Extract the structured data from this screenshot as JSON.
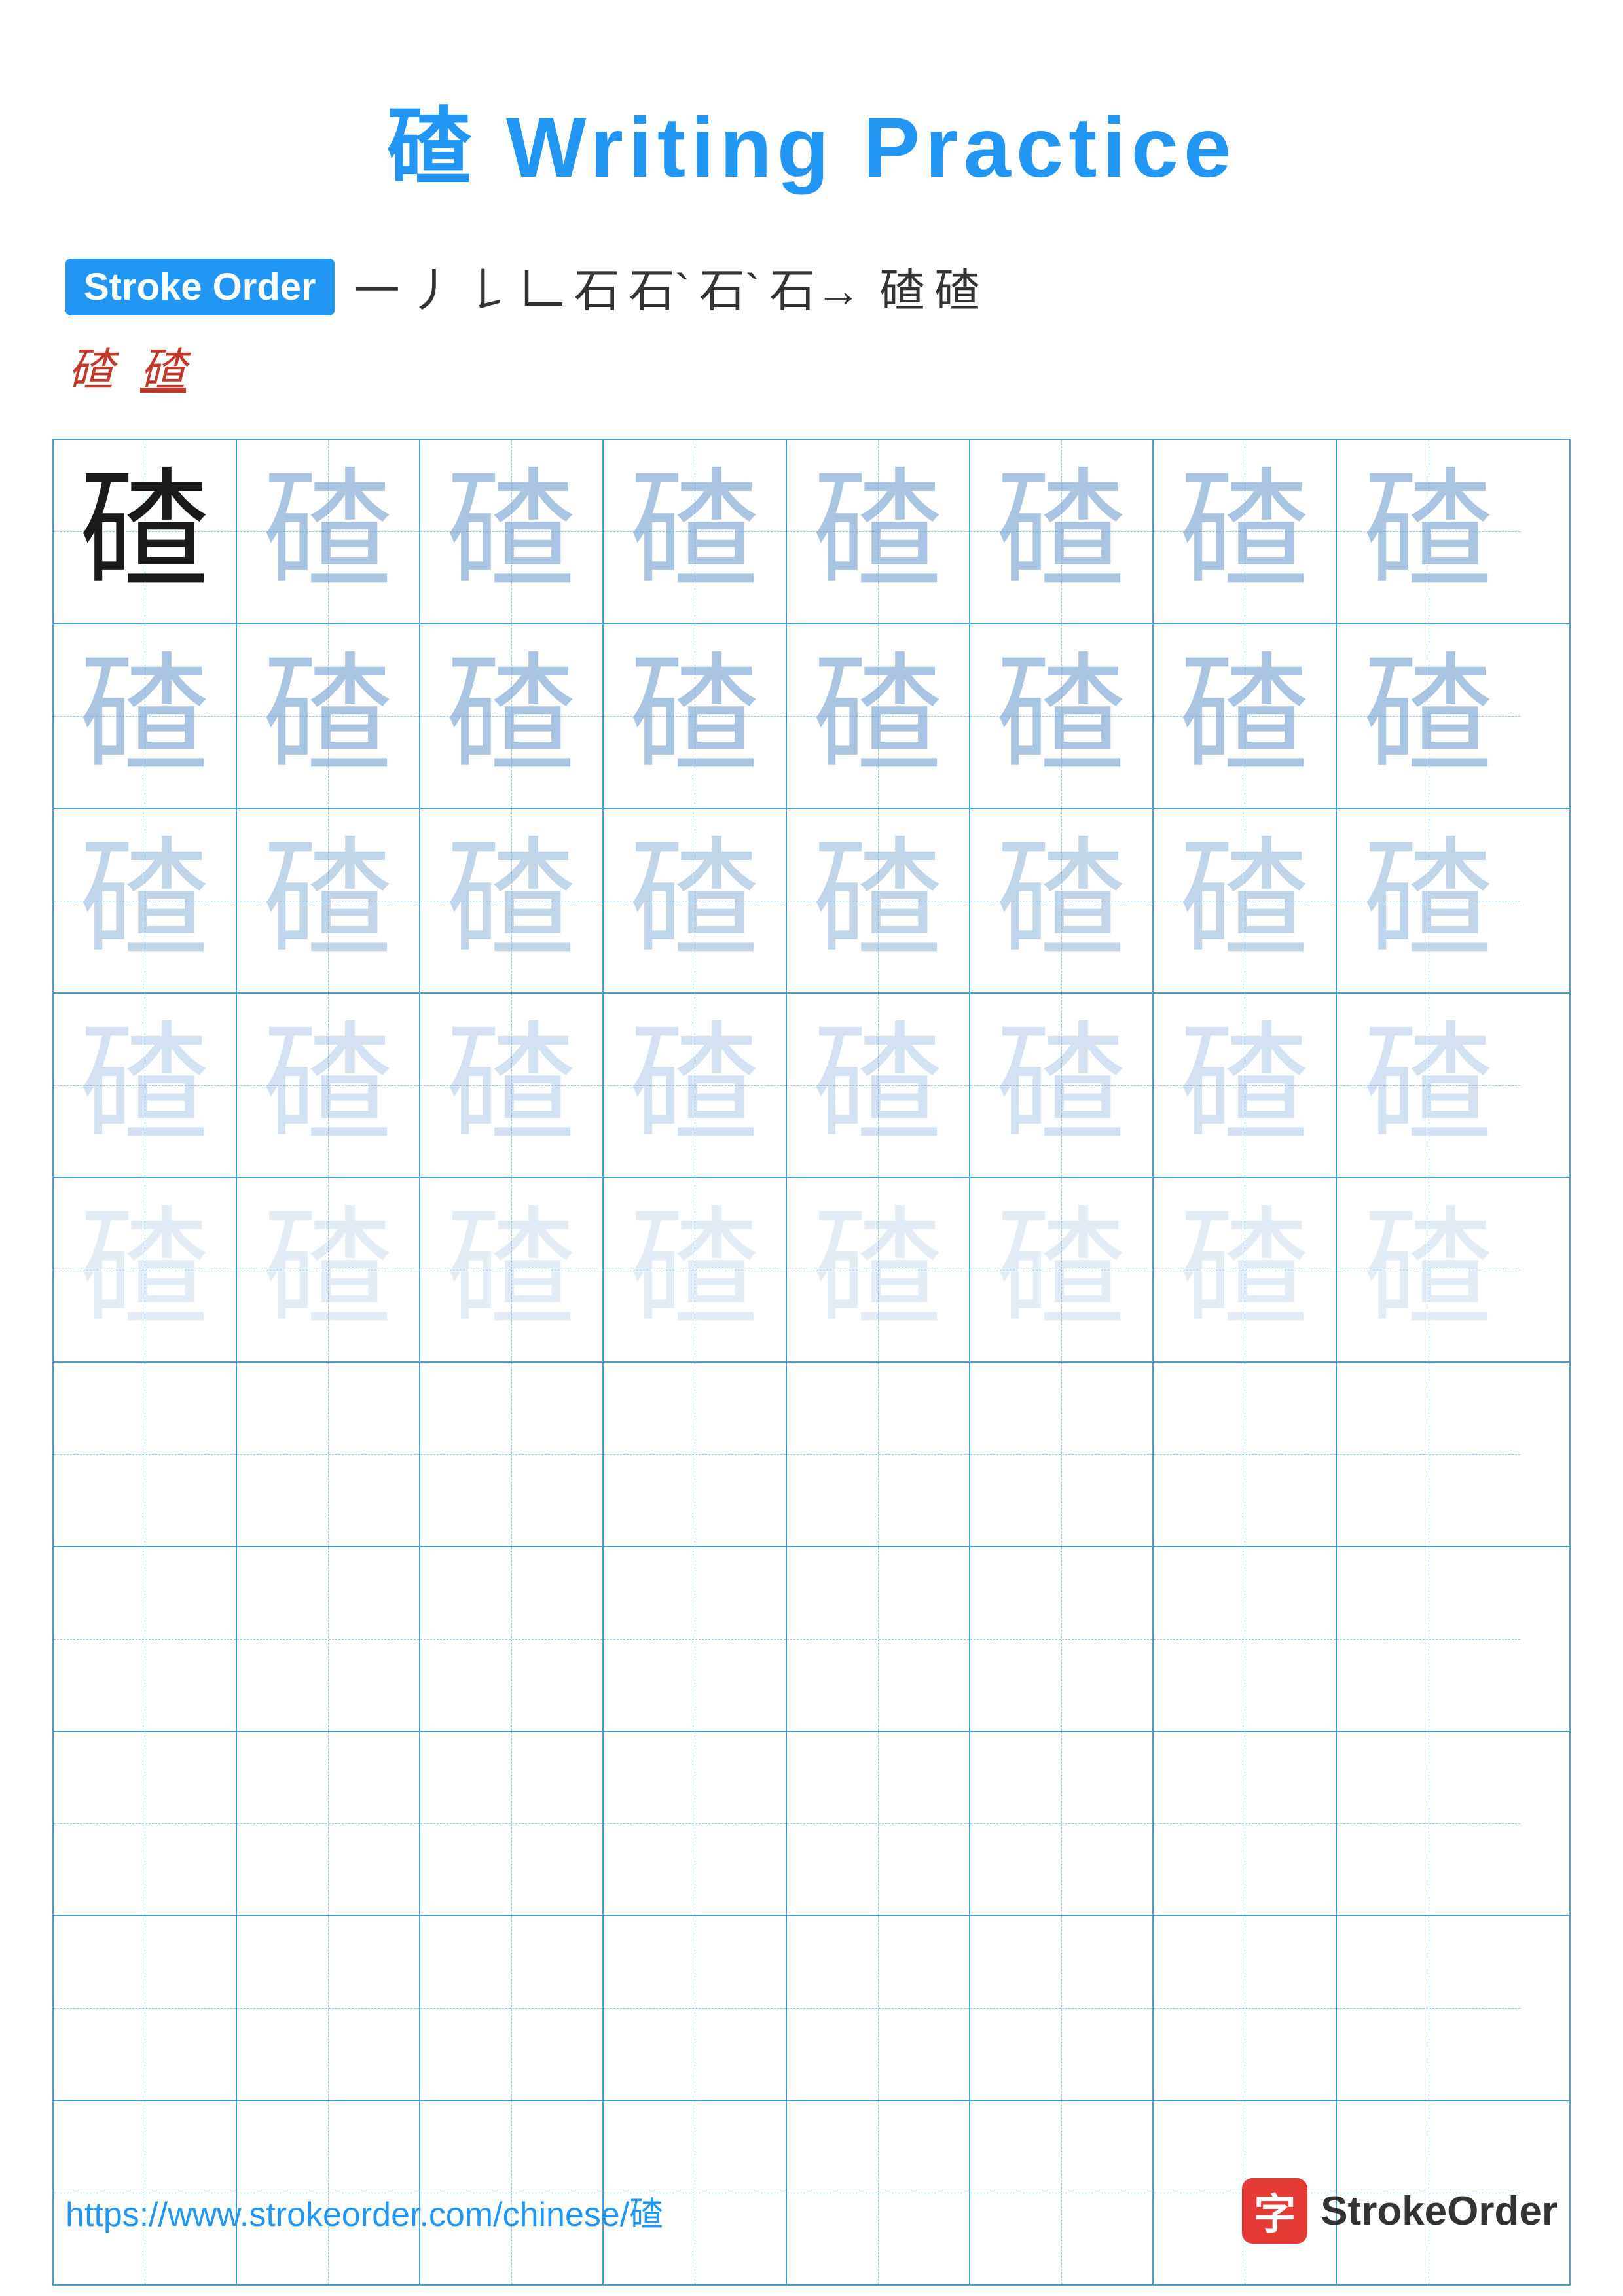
{
  "title": {
    "char": "碴",
    "text": " Writing Practice"
  },
  "stroke_order": {
    "badge_label": "Stroke Order",
    "strokes": [
      "一",
      "丿",
      "𠄌",
      "𠃊",
      "石",
      "石`",
      "石`",
      "石→",
      "𥐟",
      "碴",
      "碴"
    ],
    "second_line": [
      "碴",
      "碴"
    ]
  },
  "character": "碴",
  "grid": {
    "rows": 10,
    "cols": 8,
    "fade_rows": [
      [
        0,
        0,
        1,
        1,
        1,
        1,
        1,
        1
      ],
      [
        2,
        2,
        2,
        2,
        2,
        2,
        2,
        2
      ],
      [
        3,
        3,
        3,
        3,
        3,
        3,
        3,
        3
      ],
      [
        4,
        4,
        4,
        4,
        4,
        4,
        4,
        4
      ],
      [
        5,
        5,
        5,
        5,
        5,
        5,
        5,
        5
      ],
      [
        6,
        6,
        6,
        6,
        6,
        6,
        6,
        6
      ],
      [
        6,
        6,
        6,
        6,
        6,
        6,
        6,
        6
      ],
      [
        6,
        6,
        6,
        6,
        6,
        6,
        6,
        6
      ],
      [
        6,
        6,
        6,
        6,
        6,
        6,
        6,
        6
      ],
      [
        6,
        6,
        6,
        6,
        6,
        6,
        6,
        6
      ]
    ]
  },
  "footer": {
    "url": "https://www.strokeorder.com/chinese/碴",
    "logo_text": "StrokeOrder",
    "logo_char": "字"
  }
}
